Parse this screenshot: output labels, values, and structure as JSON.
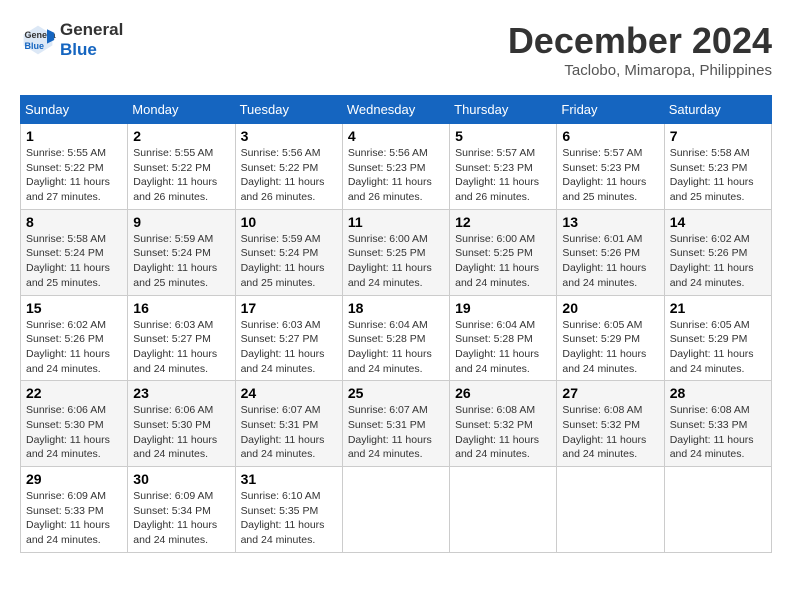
{
  "header": {
    "logo_line1": "General",
    "logo_line2": "Blue",
    "month": "December 2024",
    "location": "Taclobo, Mimaropa, Philippines"
  },
  "weekdays": [
    "Sunday",
    "Monday",
    "Tuesday",
    "Wednesday",
    "Thursday",
    "Friday",
    "Saturday"
  ],
  "weeks": [
    [
      {
        "day": "1",
        "sunrise": "5:55 AM",
        "sunset": "5:22 PM",
        "daylight": "11 hours and 27 minutes."
      },
      {
        "day": "2",
        "sunrise": "5:55 AM",
        "sunset": "5:22 PM",
        "daylight": "11 hours and 26 minutes."
      },
      {
        "day": "3",
        "sunrise": "5:56 AM",
        "sunset": "5:22 PM",
        "daylight": "11 hours and 26 minutes."
      },
      {
        "day": "4",
        "sunrise": "5:56 AM",
        "sunset": "5:23 PM",
        "daylight": "11 hours and 26 minutes."
      },
      {
        "day": "5",
        "sunrise": "5:57 AM",
        "sunset": "5:23 PM",
        "daylight": "11 hours and 26 minutes."
      },
      {
        "day": "6",
        "sunrise": "5:57 AM",
        "sunset": "5:23 PM",
        "daylight": "11 hours and 25 minutes."
      },
      {
        "day": "7",
        "sunrise": "5:58 AM",
        "sunset": "5:23 PM",
        "daylight": "11 hours and 25 minutes."
      }
    ],
    [
      {
        "day": "8",
        "sunrise": "5:58 AM",
        "sunset": "5:24 PM",
        "daylight": "11 hours and 25 minutes."
      },
      {
        "day": "9",
        "sunrise": "5:59 AM",
        "sunset": "5:24 PM",
        "daylight": "11 hours and 25 minutes."
      },
      {
        "day": "10",
        "sunrise": "5:59 AM",
        "sunset": "5:24 PM",
        "daylight": "11 hours and 25 minutes."
      },
      {
        "day": "11",
        "sunrise": "6:00 AM",
        "sunset": "5:25 PM",
        "daylight": "11 hours and 24 minutes."
      },
      {
        "day": "12",
        "sunrise": "6:00 AM",
        "sunset": "5:25 PM",
        "daylight": "11 hours and 24 minutes."
      },
      {
        "day": "13",
        "sunrise": "6:01 AM",
        "sunset": "5:26 PM",
        "daylight": "11 hours and 24 minutes."
      },
      {
        "day": "14",
        "sunrise": "6:02 AM",
        "sunset": "5:26 PM",
        "daylight": "11 hours and 24 minutes."
      }
    ],
    [
      {
        "day": "15",
        "sunrise": "6:02 AM",
        "sunset": "5:26 PM",
        "daylight": "11 hours and 24 minutes."
      },
      {
        "day": "16",
        "sunrise": "6:03 AM",
        "sunset": "5:27 PM",
        "daylight": "11 hours and 24 minutes."
      },
      {
        "day": "17",
        "sunrise": "6:03 AM",
        "sunset": "5:27 PM",
        "daylight": "11 hours and 24 minutes."
      },
      {
        "day": "18",
        "sunrise": "6:04 AM",
        "sunset": "5:28 PM",
        "daylight": "11 hours and 24 minutes."
      },
      {
        "day": "19",
        "sunrise": "6:04 AM",
        "sunset": "5:28 PM",
        "daylight": "11 hours and 24 minutes."
      },
      {
        "day": "20",
        "sunrise": "6:05 AM",
        "sunset": "5:29 PM",
        "daylight": "11 hours and 24 minutes."
      },
      {
        "day": "21",
        "sunrise": "6:05 AM",
        "sunset": "5:29 PM",
        "daylight": "11 hours and 24 minutes."
      }
    ],
    [
      {
        "day": "22",
        "sunrise": "6:06 AM",
        "sunset": "5:30 PM",
        "daylight": "11 hours and 24 minutes."
      },
      {
        "day": "23",
        "sunrise": "6:06 AM",
        "sunset": "5:30 PM",
        "daylight": "11 hours and 24 minutes."
      },
      {
        "day": "24",
        "sunrise": "6:07 AM",
        "sunset": "5:31 PM",
        "daylight": "11 hours and 24 minutes."
      },
      {
        "day": "25",
        "sunrise": "6:07 AM",
        "sunset": "5:31 PM",
        "daylight": "11 hours and 24 minutes."
      },
      {
        "day": "26",
        "sunrise": "6:08 AM",
        "sunset": "5:32 PM",
        "daylight": "11 hours and 24 minutes."
      },
      {
        "day": "27",
        "sunrise": "6:08 AM",
        "sunset": "5:32 PM",
        "daylight": "11 hours and 24 minutes."
      },
      {
        "day": "28",
        "sunrise": "6:08 AM",
        "sunset": "5:33 PM",
        "daylight": "11 hours and 24 minutes."
      }
    ],
    [
      {
        "day": "29",
        "sunrise": "6:09 AM",
        "sunset": "5:33 PM",
        "daylight": "11 hours and 24 minutes."
      },
      {
        "day": "30",
        "sunrise": "6:09 AM",
        "sunset": "5:34 PM",
        "daylight": "11 hours and 24 minutes."
      },
      {
        "day": "31",
        "sunrise": "6:10 AM",
        "sunset": "5:35 PM",
        "daylight": "11 hours and 24 minutes."
      },
      null,
      null,
      null,
      null
    ]
  ]
}
